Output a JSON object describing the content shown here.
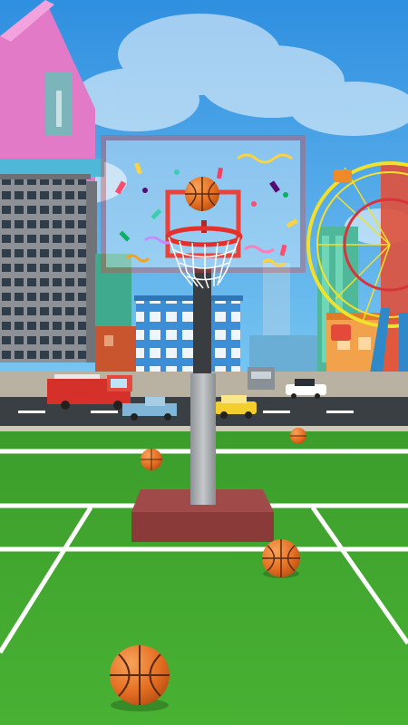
{
  "scene": {
    "type": "basketball-arcade-game",
    "colors": {
      "sky": "#3aa6e8",
      "court_grass": "#3fa82e",
      "court_lines": "#ffffff",
      "backboard_frame": "#e8423a",
      "rim": "#e4302a",
      "ball": "#e8792a",
      "pole": "#a9adb0",
      "base": "#8b3a3a",
      "road": "#3a3f44"
    },
    "background": {
      "buildings": [
        "pink-building",
        "gray-office-building",
        "blue-building",
        "orange-building",
        "green-tower"
      ],
      "vehicles": [
        "fire-truck",
        "pickup-truck",
        "yellow-taxi",
        "police-car",
        "delivery-truck"
      ],
      "attractions": [
        "ferris-wheel"
      ]
    },
    "hoop": {
      "state": "scored",
      "celebration": "confetti"
    },
    "balls_on_court": 4,
    "ball_in_hoop": true
  }
}
